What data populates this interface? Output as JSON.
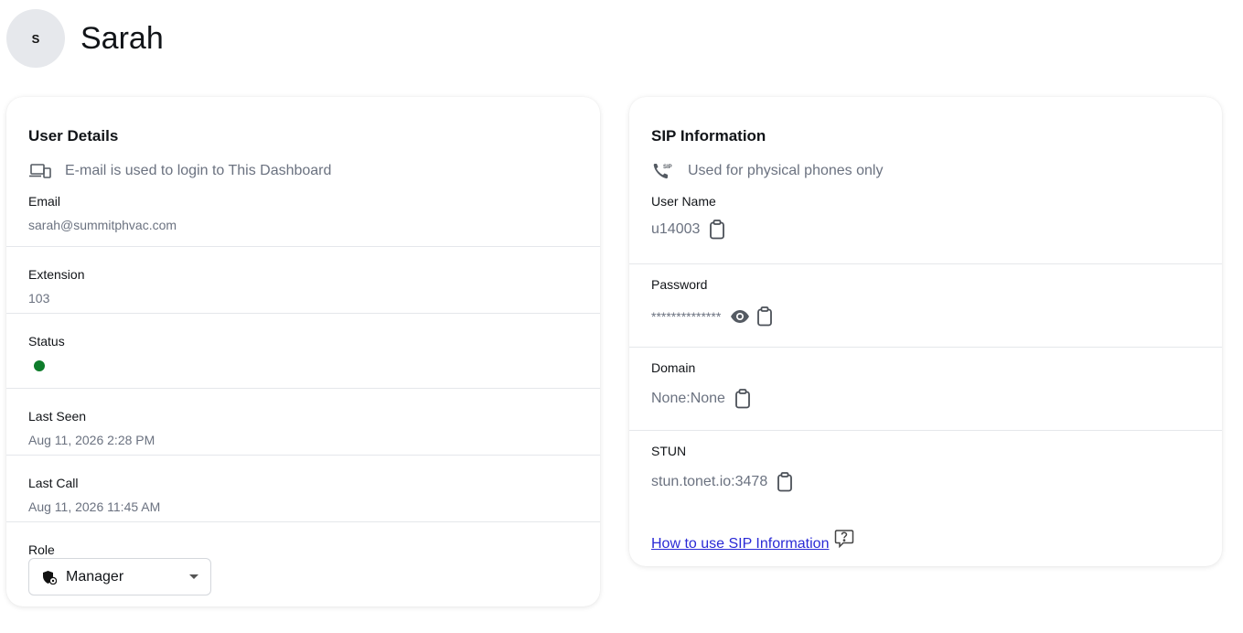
{
  "user": {
    "initial": "S",
    "name": "Sarah"
  },
  "user_details": {
    "title": "User Details",
    "hint": "E-mail is used to login to This Dashboard",
    "email": {
      "label": "Email",
      "value": "sarah@summitphvac.com"
    },
    "extension": {
      "label": "Extension",
      "value": "103"
    },
    "status": {
      "label": "Status",
      "color": "#0e7c2b"
    },
    "last_seen": {
      "label": "Last Seen",
      "value": "Aug 11, 2026 2:28 PM"
    },
    "last_call": {
      "label": "Last Call",
      "value": "Aug 11, 2026 11:45 AM"
    },
    "role": {
      "label": "Role",
      "selected": "Manager"
    }
  },
  "sip": {
    "title": "SIP Information",
    "hint": "Used for physical phones only",
    "hint_icon_text": "SIP",
    "username": {
      "label": "User Name",
      "value": "u14003"
    },
    "password": {
      "label": "Password",
      "value": "**************"
    },
    "domain": {
      "label": "Domain",
      "value": "None:None"
    },
    "stun": {
      "label": "STUN",
      "value": "stun.tonet.io:3478"
    },
    "help_link": "How to use SIP Information"
  },
  "icons": [
    "devices-icon",
    "sip-phone-icon",
    "copy-icon",
    "eye-icon",
    "shield-icon",
    "chevron-down-icon",
    "help-bubble-icon"
  ]
}
